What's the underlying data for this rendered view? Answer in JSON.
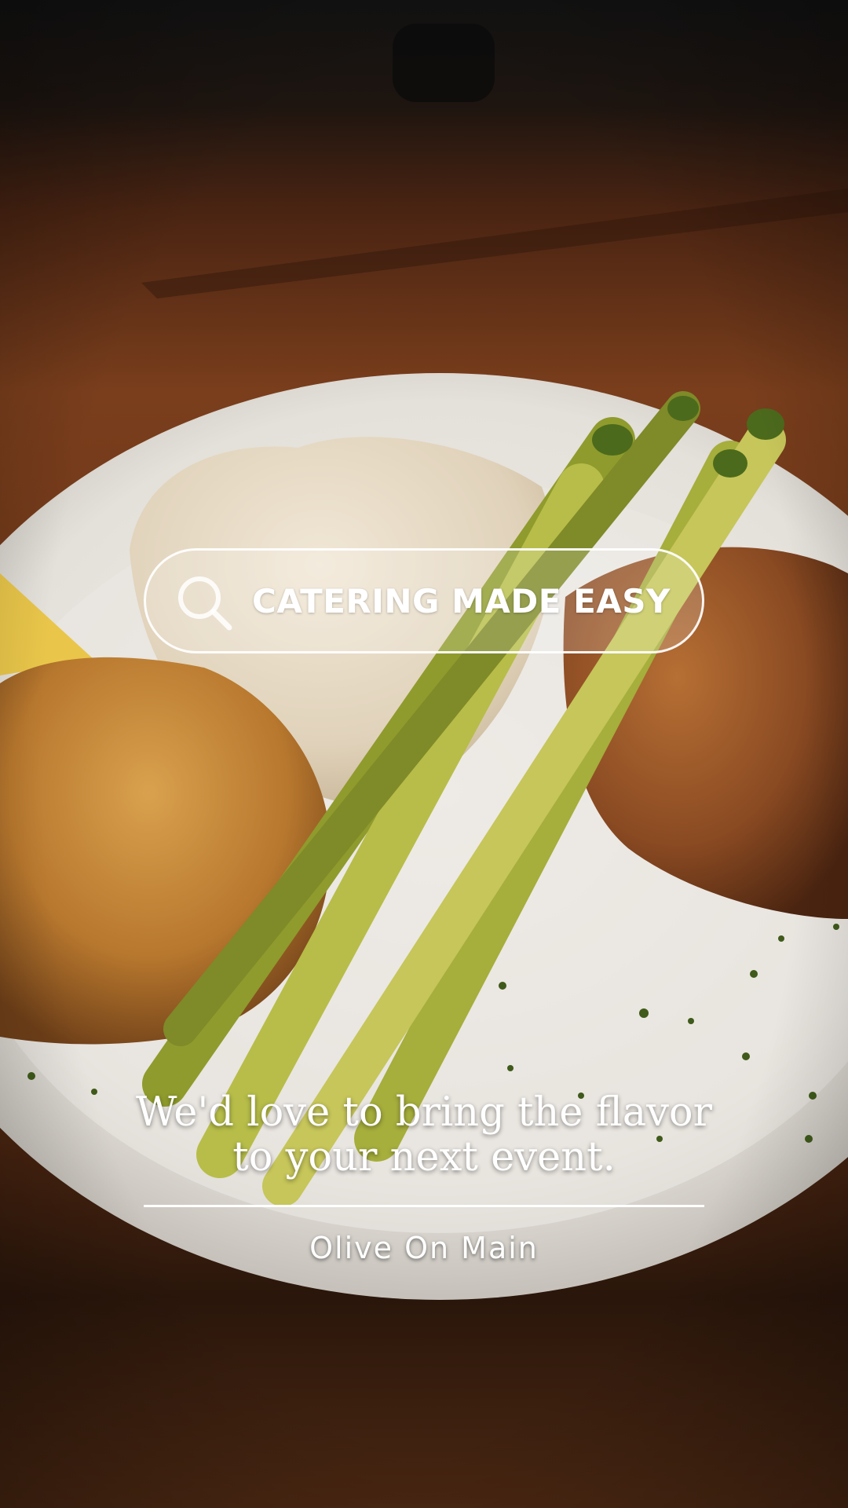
{
  "colors": {
    "text": "#ffffff",
    "table_wood": "#7a3e1c",
    "plate": "#e9e6e1",
    "crab_cake": "#b8782e",
    "asparagus": "#a7b13a",
    "mashed_potato": "#e8dcc6"
  },
  "search": {
    "icon": "search-icon",
    "label": "CATERING MADE EASY"
  },
  "message": {
    "line1": "We'd love to bring the flavor",
    "line2": "to your next event."
  },
  "brand": {
    "name": "Olive On Main"
  }
}
